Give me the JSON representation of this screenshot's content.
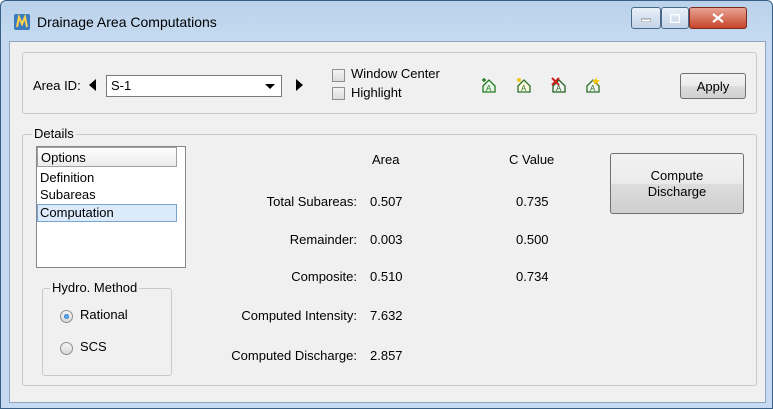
{
  "window": {
    "title": "Drainage Area Computations"
  },
  "toolbar": {
    "area_id_label": "Area ID:",
    "area_id_value": "S-1",
    "window_center_label": "Window Center",
    "highlight_label": "Highlight",
    "apply_label": "Apply",
    "icons": [
      "add-area-icon",
      "edit-area-icon",
      "delete-area-icon",
      "locate-area-icon"
    ]
  },
  "details": {
    "group_title": "Details",
    "options_header": "Options",
    "options": [
      "Definition",
      "Subareas",
      "Computation"
    ],
    "selected_option": "Computation",
    "hydro_method": {
      "title": "Hydro. Method",
      "options": [
        "Rational",
        "SCS"
      ],
      "selected": "Rational"
    },
    "columns": {
      "area": "Area",
      "c_value": "C Value"
    },
    "rows": [
      {
        "label": "Total Subareas:",
        "area": "0.507",
        "c_value": "0.735"
      },
      {
        "label": "Remainder:",
        "area": "0.003",
        "c_value": "0.500"
      },
      {
        "label": "Composite:",
        "area": "0.510",
        "c_value": "0.734"
      },
      {
        "label": "Computed Intensity:",
        "area": "7.632",
        "c_value": ""
      },
      {
        "label": "Computed Discharge:",
        "area": "2.857",
        "c_value": ""
      }
    ],
    "compute_button": "Compute\nDischarge"
  },
  "colors": {
    "titlebar": "#c6dbf1",
    "client": "#f0f0f0",
    "selection": "#dcebfc",
    "close_button": "#c7452d"
  }
}
